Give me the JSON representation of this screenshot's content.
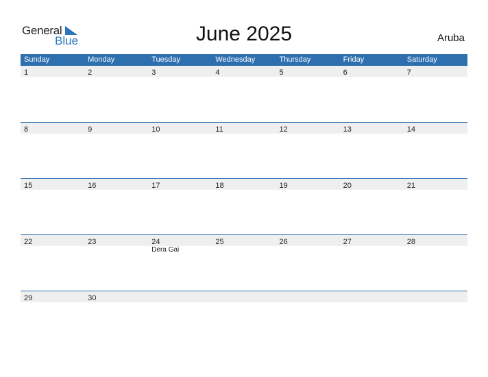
{
  "logo": {
    "part1": "General",
    "part2": "Blue",
    "accent_color": "#2a75bb"
  },
  "title": "June 2025",
  "country": "Aruba",
  "header_color": "#2e6fb0",
  "weekdays": [
    "Sunday",
    "Monday",
    "Tuesday",
    "Wednesday",
    "Thursday",
    "Friday",
    "Saturday"
  ],
  "weeks": [
    {
      "days": [
        "1",
        "2",
        "3",
        "4",
        "5",
        "6",
        "7"
      ],
      "events": [
        "",
        "",
        "",
        "",
        "",
        "",
        ""
      ]
    },
    {
      "days": [
        "8",
        "9",
        "10",
        "11",
        "12",
        "13",
        "14"
      ],
      "events": [
        "",
        "",
        "",
        "",
        "",
        "",
        ""
      ]
    },
    {
      "days": [
        "15",
        "16",
        "17",
        "18",
        "19",
        "20",
        "21"
      ],
      "events": [
        "",
        "",
        "",
        "",
        "",
        "",
        ""
      ]
    },
    {
      "days": [
        "22",
        "23",
        "24",
        "25",
        "26",
        "27",
        "28"
      ],
      "events": [
        "",
        "",
        "Dera Gai",
        "",
        "",
        "",
        ""
      ]
    },
    {
      "days": [
        "29",
        "30",
        "",
        "",
        "",
        "",
        ""
      ],
      "events": [
        "",
        "",
        "",
        "",
        "",
        "",
        ""
      ]
    }
  ]
}
